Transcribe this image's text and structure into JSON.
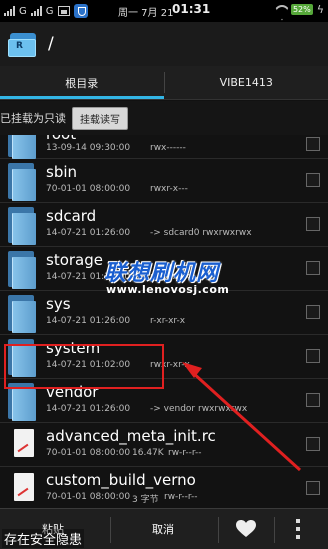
{
  "status_bar": {
    "carrier1": "G",
    "carrier2": "G",
    "date": "周一 7月 21",
    "time": "01:31",
    "battery": "52%"
  },
  "action_bar": {
    "path": "/"
  },
  "tabs": [
    {
      "label": "根目录",
      "active": true
    },
    {
      "label": "VIBE1413",
      "active": false
    }
  ],
  "mount_bar": {
    "status": "已挂载为只读",
    "button": "挂载读写"
  },
  "files": [
    {
      "name": "root",
      "date": "13-09-14 09:30:00",
      "info": "rwx------",
      "type": "folder"
    },
    {
      "name": "sbin",
      "date": "70-01-01 08:00:00",
      "info": "rwxr-x---",
      "type": "folder"
    },
    {
      "name": "sdcard",
      "date": "14-07-21 01:26:00",
      "info": "-> sdcard0  rwxrwxrwx",
      "type": "folder"
    },
    {
      "name": "storage",
      "date": "14-07-21 01:26:00",
      "info": "rwxr-x--x",
      "type": "folder"
    },
    {
      "name": "sys",
      "date": "14-07-21 01:26:00",
      "info": "r-xr-xr-x",
      "type": "folder"
    },
    {
      "name": "system",
      "date": "14-07-21 01:02:00",
      "info": "rwxr-xr-x",
      "type": "folder"
    },
    {
      "name": "vendor",
      "date": "14-07-21 01:26:00",
      "info": "-> vendor  rwxrwxrwx",
      "type": "folder"
    },
    {
      "name": "advanced_meta_init.rc",
      "date": "70-01-01 08:00:00",
      "size": "16.47K",
      "info": "rw-r--r--",
      "type": "file"
    },
    {
      "name": "custom_build_verno",
      "date": "70-01-01 08:00:00",
      "size": "3 字节",
      "info": "rw-r--r--",
      "type": "file"
    }
  ],
  "watermark": {
    "cn": "联想刷机网",
    "url": "www.lenovosj.com"
  },
  "bottom_bar": {
    "paste": "粘贴",
    "cancel": "取消"
  },
  "overlay_text": "存在安全隐患",
  "colors": {
    "accent": "#33b5e5",
    "highlight": "#e02020",
    "battery": "#56a83a"
  }
}
